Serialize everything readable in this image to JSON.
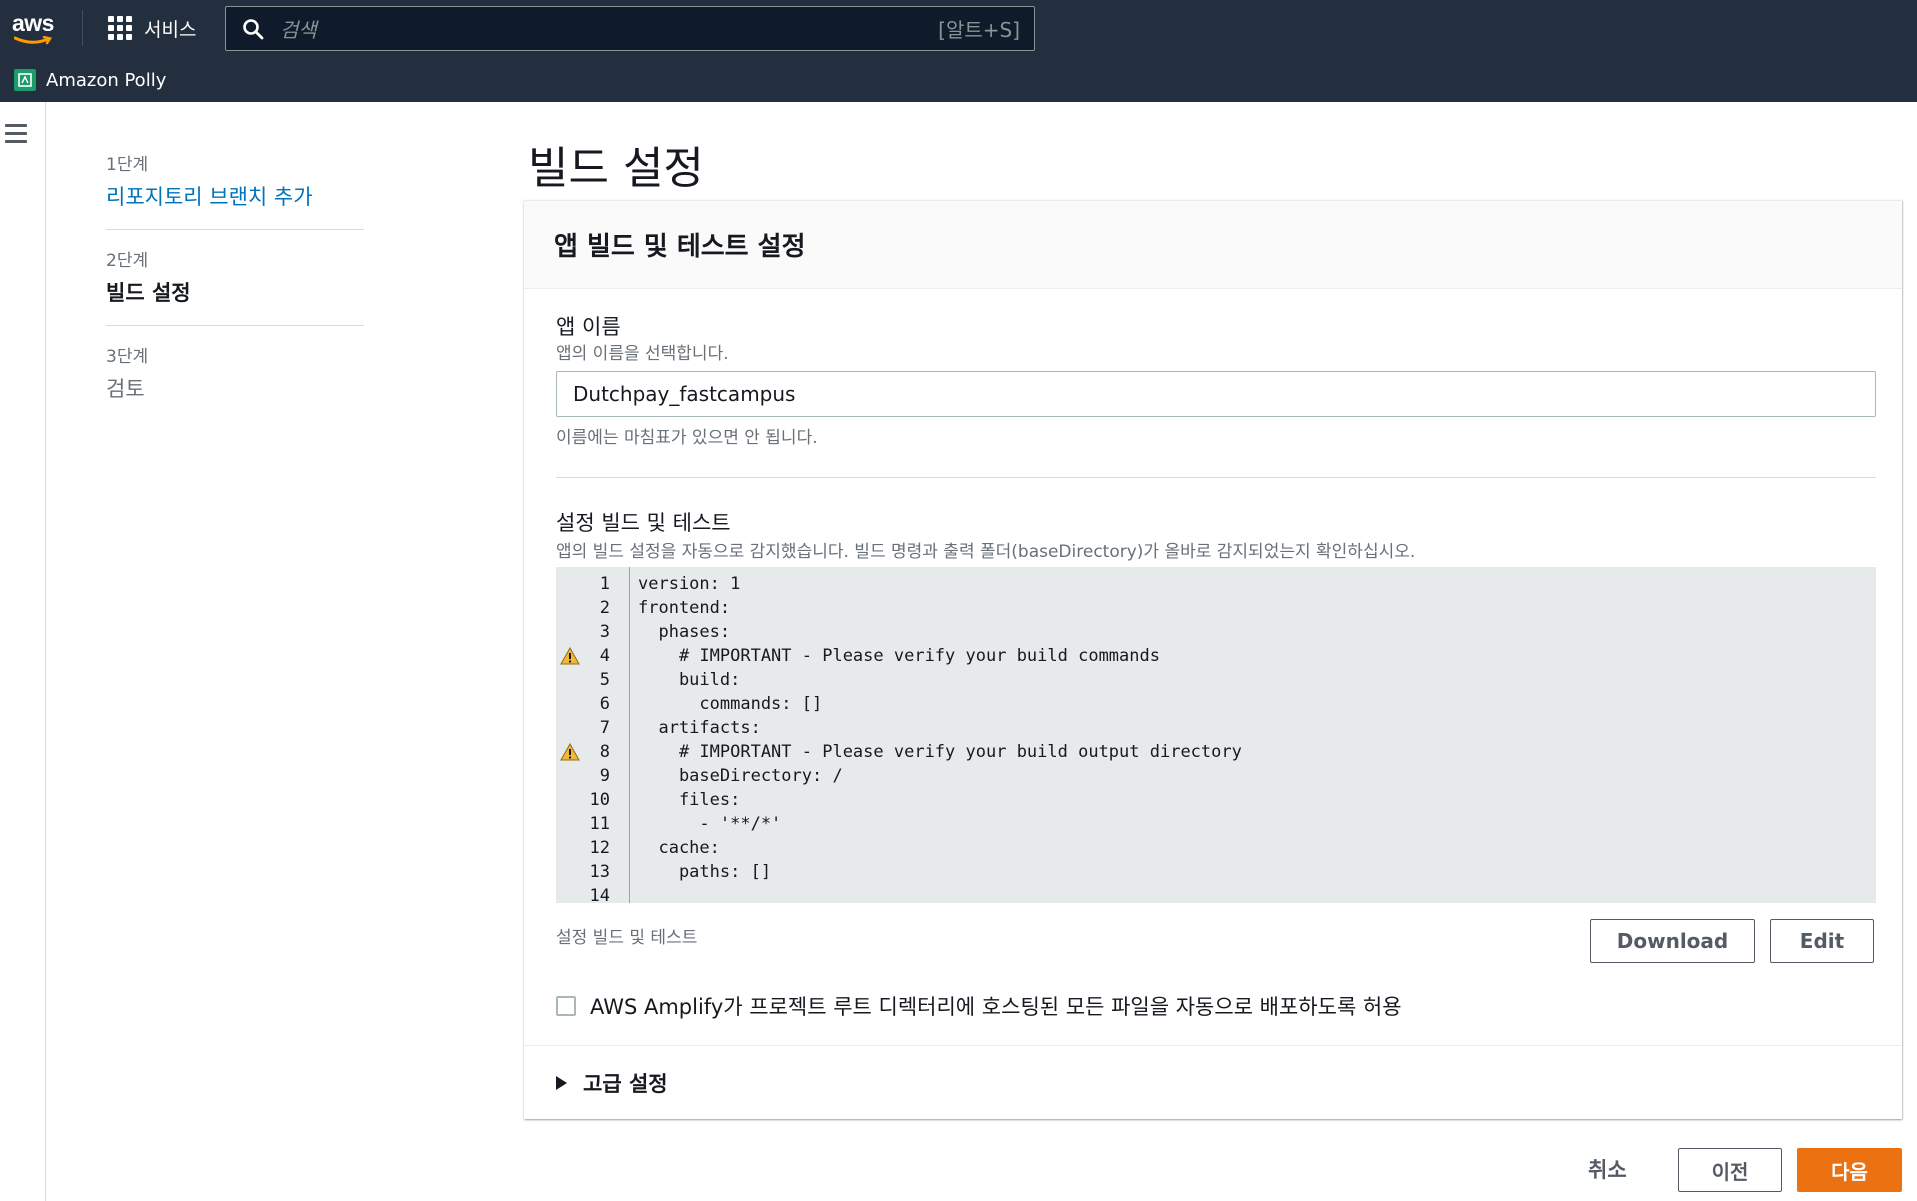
{
  "topnav": {
    "logo_text": "aws",
    "services_label": "서비스",
    "search_placeholder": "검색",
    "search_shortcut": "[알트+S]",
    "service_name": "Amazon Polly"
  },
  "steps": [
    {
      "num": "1단계",
      "title": "리포지토리 브랜치 추가",
      "state": "link"
    },
    {
      "num": "2단계",
      "title": "빌드 설정",
      "state": "current"
    },
    {
      "num": "3단계",
      "title": "검토",
      "state": "disabled"
    }
  ],
  "page_title": "빌드 설정",
  "container": {
    "header": "앱 빌드 및 테스트 설정",
    "app_name": {
      "label": "앱 이름",
      "description": "앱의 이름을 선택합니다.",
      "value": "Dutchpay_fastcampus",
      "constraint": "이름에는 마침표가 있으면 안 됩니다."
    },
    "build_settings": {
      "label": "설정 빌드 및 테스트",
      "description": "앱의 빌드 설정을 자동으로 감지했습니다. 빌드 명령과 출력 폴더(baseDirectory)가 올바로 감지되었는지 확인하십시오.",
      "code_lines": [
        {
          "n": "1",
          "text": "version: 1",
          "warn": false
        },
        {
          "n": "2",
          "text": "frontend:",
          "warn": false
        },
        {
          "n": "3",
          "text": "  phases:",
          "warn": false
        },
        {
          "n": "4",
          "text": "    # IMPORTANT - Please verify your build commands",
          "warn": true
        },
        {
          "n": "5",
          "text": "    build:",
          "warn": false
        },
        {
          "n": "6",
          "text": "      commands: []",
          "warn": false
        },
        {
          "n": "7",
          "text": "  artifacts:",
          "warn": false
        },
        {
          "n": "8",
          "text": "    # IMPORTANT - Please verify your build output directory",
          "warn": true
        },
        {
          "n": "9",
          "text": "    baseDirectory: /",
          "warn": false
        },
        {
          "n": "10",
          "text": "    files:",
          "warn": false
        },
        {
          "n": "11",
          "text": "      - '**/*'",
          "warn": false
        },
        {
          "n": "12",
          "text": "  cache:",
          "warn": false
        },
        {
          "n": "13",
          "text": "    paths: []",
          "warn": false
        },
        {
          "n": "14",
          "text": "",
          "warn": false
        }
      ],
      "caption": "설정 빌드 및 테스트",
      "download_label": "Download",
      "edit_label": "Edit"
    },
    "auto_deploy_label": "AWS Amplify가 프로젝트 루트 디렉터리에 호스팅된 모든 파일을 자동으로 배포하도록 허용",
    "auto_deploy_checked": false,
    "advanced_label": "고급 설정"
  },
  "footer": {
    "cancel_label": "취소",
    "previous_label": "이전",
    "next_label": "다음"
  },
  "colors": {
    "nav_bg": "#232f3e",
    "link": "#0073bb",
    "primary": "#ec7211",
    "warning": "#f2b733"
  }
}
